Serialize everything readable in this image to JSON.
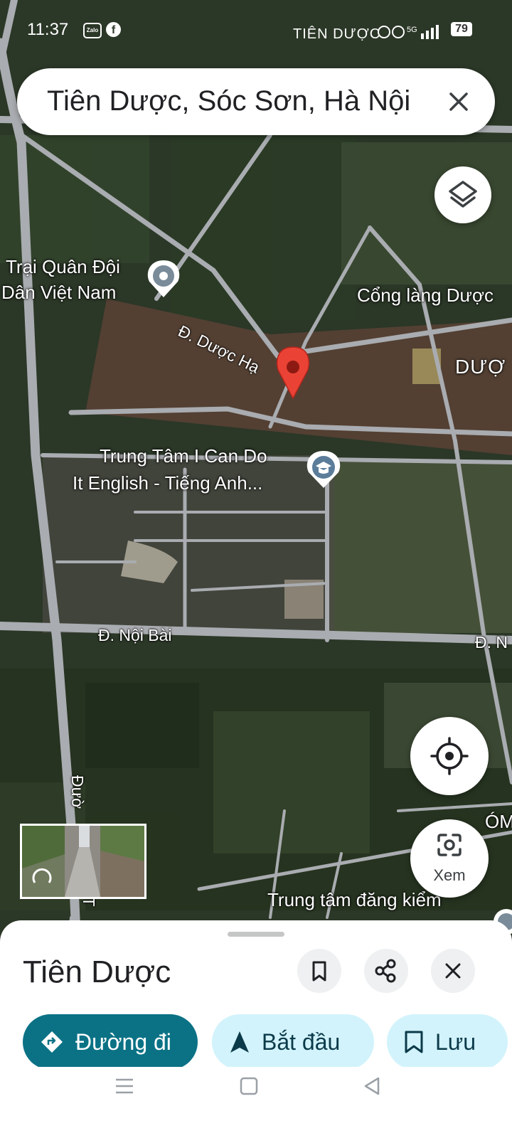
{
  "status_bar": {
    "time": "11:37",
    "zalo_text": "Zalo",
    "fb_text": "f",
    "carrier": "TIÊN DƯỢC",
    "network": "5G",
    "battery": "79"
  },
  "search": {
    "query": "Tiên Dược, Sóc Sơn, Hà Nội",
    "close_icon": "close-icon"
  },
  "map": {
    "labels": {
      "military_camp_line1": "Trại Quân Đội",
      "military_camp_line2": "Dân Việt Nam",
      "village_gate": "Cổng làng Dược",
      "area_right": "DƯỢ",
      "street_duoc_ha": "Đ. Dược Hạ",
      "center_line1": "Trung Tâm I Can Do",
      "center_line2": "It English - Tiếng Anh...",
      "street_noi_bai": "Đ. Nội Bài",
      "street_noi_bai_right": "Đ. N",
      "street_vertical_top": "Đườ",
      "street_vertical_bottom": "ĐT",
      "right_edge": "ÓM",
      "inspection": "Trung tâm đăng kiểm"
    },
    "colors": {
      "pin": "#ea4335",
      "poi_gray": "#7a8b99",
      "poi_school": "#5b7d9a",
      "road": "#a9acb0"
    }
  },
  "controls": {
    "layers_icon": "layers-icon",
    "locate_icon": "my-location-icon",
    "view_icon": "camera-icon",
    "view_label": "Xem"
  },
  "sheet": {
    "title": "Tiên Dược",
    "actions": {
      "directions_label": "Đường đi",
      "start_label": "Bắt đầu",
      "save_label": "Lưu"
    },
    "icons": [
      "bookmark-icon",
      "share-icon",
      "close-icon"
    ]
  },
  "nav_bar": {
    "icons": [
      "menu-icon",
      "home-icon",
      "back-icon"
    ]
  }
}
